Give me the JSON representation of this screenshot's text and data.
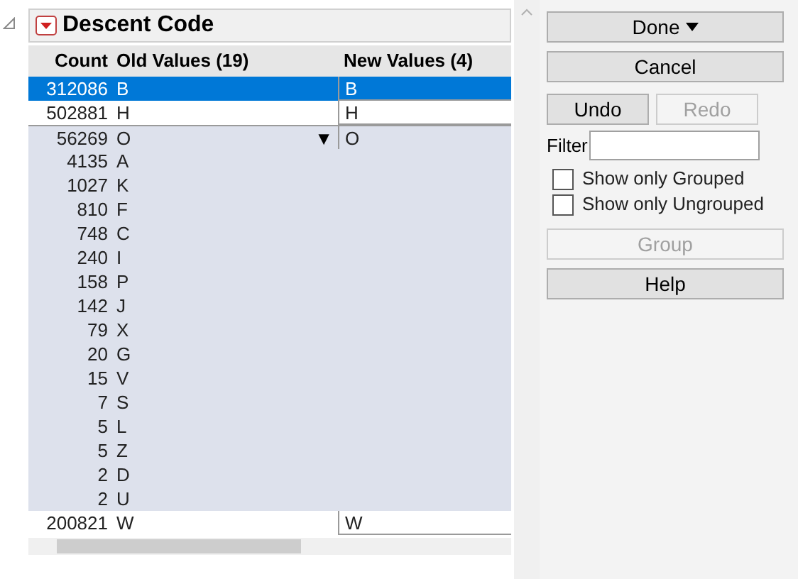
{
  "panel": {
    "title": "Descent Code"
  },
  "table": {
    "columns": [
      "Count",
      "Old Values (19)",
      "New Values (4)"
    ],
    "groups": [
      {
        "new_value": "B",
        "selected": true,
        "grouped": false,
        "members": [
          {
            "count": "312086",
            "value": "B"
          }
        ]
      },
      {
        "new_value": "H",
        "selected": false,
        "grouped": false,
        "members": [
          {
            "count": "502881",
            "value": "H"
          }
        ]
      },
      {
        "new_value": "O",
        "selected": false,
        "grouped": true,
        "toggle": "▼",
        "members": [
          {
            "count": "56269",
            "value": "O"
          },
          {
            "count": "4135",
            "value": "A"
          },
          {
            "count": "1027",
            "value": "K"
          },
          {
            "count": "810",
            "value": "F"
          },
          {
            "count": "748",
            "value": "C"
          },
          {
            "count": "240",
            "value": "I"
          },
          {
            "count": "158",
            "value": "P"
          },
          {
            "count": "142",
            "value": "J"
          },
          {
            "count": "79",
            "value": "X"
          },
          {
            "count": "20",
            "value": "G"
          },
          {
            "count": "15",
            "value": "V"
          },
          {
            "count": "7",
            "value": "S"
          },
          {
            "count": "5",
            "value": "L"
          },
          {
            "count": "5",
            "value": "Z"
          },
          {
            "count": "2",
            "value": "D"
          },
          {
            "count": "2",
            "value": "U"
          }
        ]
      },
      {
        "new_value": "W",
        "selected": false,
        "grouped": false,
        "members": [
          {
            "count": "200821",
            "value": "W"
          }
        ]
      }
    ]
  },
  "buttons_top": [
    {
      "label": "Done",
      "kind": "menu",
      "disabled": false
    },
    {
      "label": "Cancel",
      "kind": "plain",
      "disabled": false
    }
  ],
  "undo_redo": [
    {
      "label": "Undo",
      "disabled": false
    },
    {
      "label": "Redo",
      "disabled": true
    }
  ],
  "filter": {
    "label": "Filter"
  },
  "checkboxes": [
    {
      "label": "Show only Grouped",
      "checked": false
    },
    {
      "label": "Show only Ungrouped",
      "checked": false
    }
  ],
  "buttons_bottom": [
    {
      "label": "Group",
      "disabled": true
    },
    {
      "label": "Help",
      "disabled": false
    }
  ]
}
